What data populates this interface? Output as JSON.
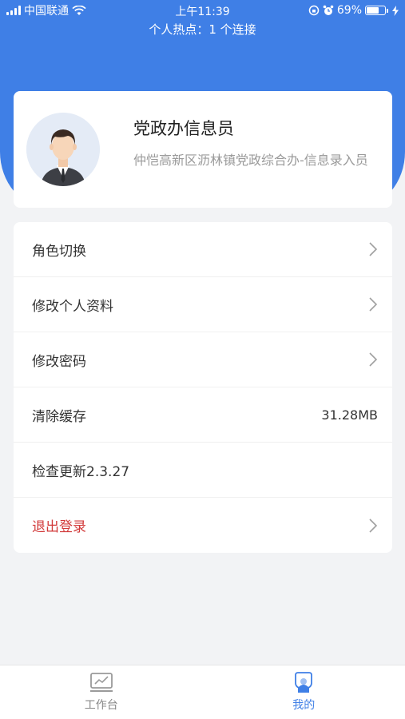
{
  "status_bar": {
    "carrier": "中国联通",
    "time": "上午11:39",
    "battery": "69%",
    "battery_level": 0.69
  },
  "hotspot_text": "个人热点：1 个连接",
  "profile": {
    "name": "党政办信息员",
    "organization": "仲恺高新区沥林镇党政综合办-信息录入员"
  },
  "menu": {
    "items": [
      {
        "label": "角色切换"
      },
      {
        "label": "修改个人资料"
      },
      {
        "label": "修改密码"
      },
      {
        "label": "清除缓存",
        "value": "31.28MB"
      },
      {
        "label": "检查更新2.3.27"
      },
      {
        "label": "退出登录"
      }
    ]
  },
  "tabbar": {
    "tabs": [
      {
        "label": "工作台",
        "icon": "workbench-icon"
      },
      {
        "label": "我的",
        "icon": "profile-icon"
      }
    ]
  },
  "colors": {
    "accent": "#3f7fe6",
    "logout": "#d23a3a"
  }
}
